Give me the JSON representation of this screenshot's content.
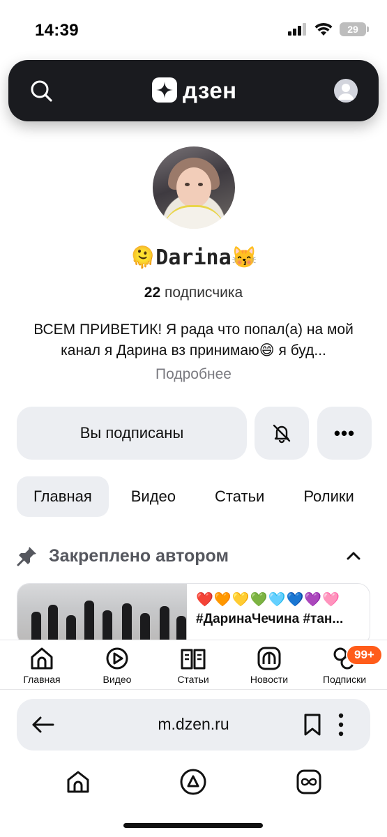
{
  "status_bar": {
    "time": "14:39",
    "battery": "29"
  },
  "header": {
    "logo_text": "дзен",
    "search_icon": "search-icon",
    "user_icon": "user-icon"
  },
  "channel": {
    "name": "🫠Darina😽",
    "subscribers_count": "22",
    "subscribers_label": "подписчика",
    "description": "ВСЕМ ПРИВЕТИК! Я рада что попал(а) на мой канал я Дарина вз принимаю😄 я буд...",
    "more_label": "Подробнее"
  },
  "actions": {
    "subscribed_label": "Вы подписаны",
    "bell_icon": "bell-off-icon",
    "more_label": "•••"
  },
  "tabs": [
    {
      "label": "Главная",
      "active": true
    },
    {
      "label": "Видео",
      "active": false
    },
    {
      "label": "Статьи",
      "active": false
    },
    {
      "label": "Ролики",
      "active": false
    }
  ],
  "pinned": {
    "label": "Закреплено автором",
    "card": {
      "emojis": "❤️🧡💛💚🩵💙💜🩷",
      "title": "#ДаринаЧечина #тан..."
    }
  },
  "bottom_nav": [
    {
      "label": "Главная",
      "icon": "home-icon"
    },
    {
      "label": "Видео",
      "icon": "video-icon"
    },
    {
      "label": "Статьи",
      "icon": "articles-icon"
    },
    {
      "label": "Новости",
      "icon": "news-icon"
    },
    {
      "label": "Подписки",
      "icon": "subscriptions-icon"
    }
  ],
  "badge": "99+",
  "browser": {
    "url": "m.dzen.ru"
  },
  "colors": {
    "header_bg": "#1a1b1f",
    "badge": "#ff5c1a",
    "button_bg": "#eceef2"
  }
}
